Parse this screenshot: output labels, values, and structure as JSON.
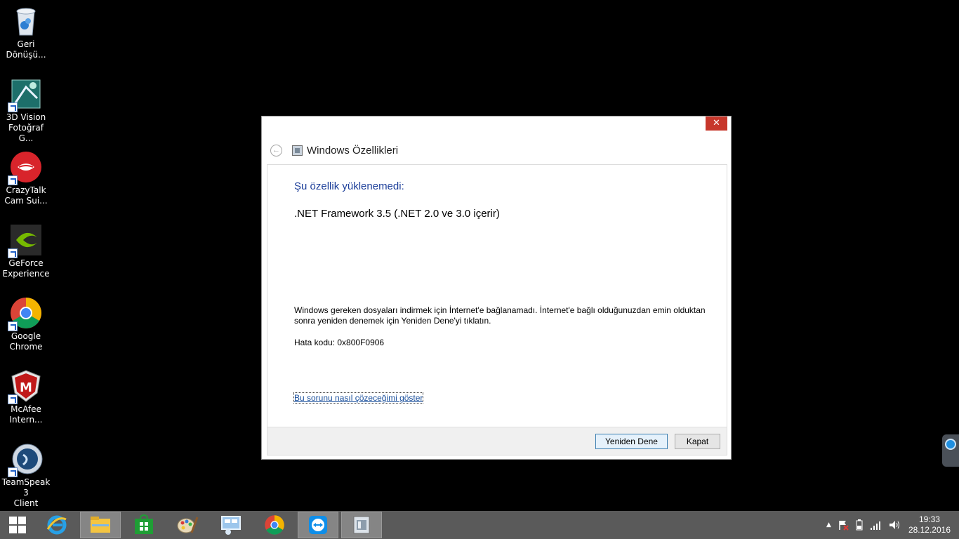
{
  "desktop": {
    "icons": [
      {
        "label_line1": "Geri",
        "label_line2": "Dönüşü...",
        "icon": "recycle-bin-icon",
        "color": "#3a8fd8"
      },
      {
        "label_line1": "3D Vision",
        "label_line2": "Fotoğraf G...",
        "icon": "3d-vision-icon",
        "color": "#1b6b6b"
      },
      {
        "label_line1": "CrazyTalk",
        "label_line2": "Cam Sui...",
        "icon": "crazytalk-icon",
        "color": "#d8242b"
      },
      {
        "label_line1": "GeForce",
        "label_line2": "Experience",
        "icon": "geforce-icon",
        "color": "#76b900"
      },
      {
        "label_line1": "Google",
        "label_line2": "Chrome",
        "icon": "chrome-icon",
        "color": "#4285f4"
      },
      {
        "label_line1": "McAfee",
        "label_line2": "Intern...",
        "icon": "mcafee-icon",
        "color": "#c01818"
      },
      {
        "label_line1": "TeamSpeak 3",
        "label_line2": "Client",
        "icon": "teamspeak-icon",
        "color": "#1d4a7a"
      }
    ]
  },
  "dialog": {
    "close_label": "✕",
    "title": "Windows Özellikleri",
    "heading": "Şu özellik yüklenemedi:",
    "feature": ".NET Framework 3.5 (.NET 2.0 ve 3.0 içerir)",
    "message": "Windows gereken dosyaları indirmek için İnternet'e bağlanamadı. İnternet'e bağlı olduğunuzdan emin olduktan sonra yeniden denemek için Yeniden Dene'yi tıklatın.",
    "error_code": "Hata kodu: 0x800F0906",
    "help_link": "Bu sorunu nasıl çözeceğimi göster",
    "retry_label": "Yeniden Dene",
    "close_button_label": "Kapat"
  },
  "taskbar": {
    "clock_time": "19:33",
    "clock_date": "28.12.2016",
    "tray_up_arrow": "▲"
  },
  "colors": {
    "heading": "#1d3f9a",
    "close_button": "#c7372b",
    "taskbar": "#5a5a5a"
  }
}
